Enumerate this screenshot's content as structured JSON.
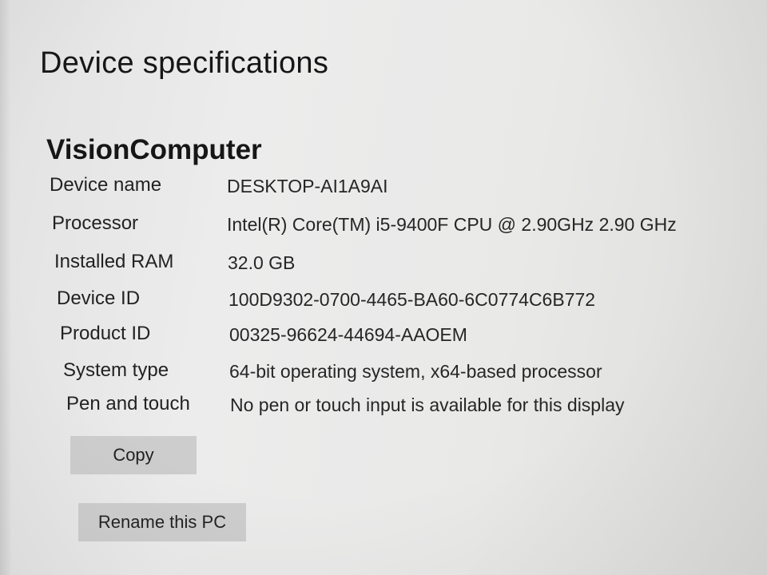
{
  "section": {
    "title": "Device specifications",
    "brand": "VisionComputer"
  },
  "specs": [
    {
      "label": "Device name",
      "value": "DESKTOP-AI1A9AI"
    },
    {
      "label": "Processor",
      "value": "Intel(R) Core(TM) i5-9400F CPU @ 2.90GHz   2.90 GHz"
    },
    {
      "label": "Installed RAM",
      "value": "32.0 GB"
    },
    {
      "label": "Device ID",
      "value": "100D9302-0700-4465-BA60-6C0774C6B772"
    },
    {
      "label": "Product ID",
      "value": "00325-96624-44694-AAOEM"
    },
    {
      "label": "System type",
      "value": "64-bit operating system, x64-based processor"
    },
    {
      "label": "Pen and touch",
      "value": "No pen or touch input is available for this display"
    }
  ],
  "buttons": {
    "copy_label": "Copy",
    "rename_label": "Rename this PC"
  }
}
